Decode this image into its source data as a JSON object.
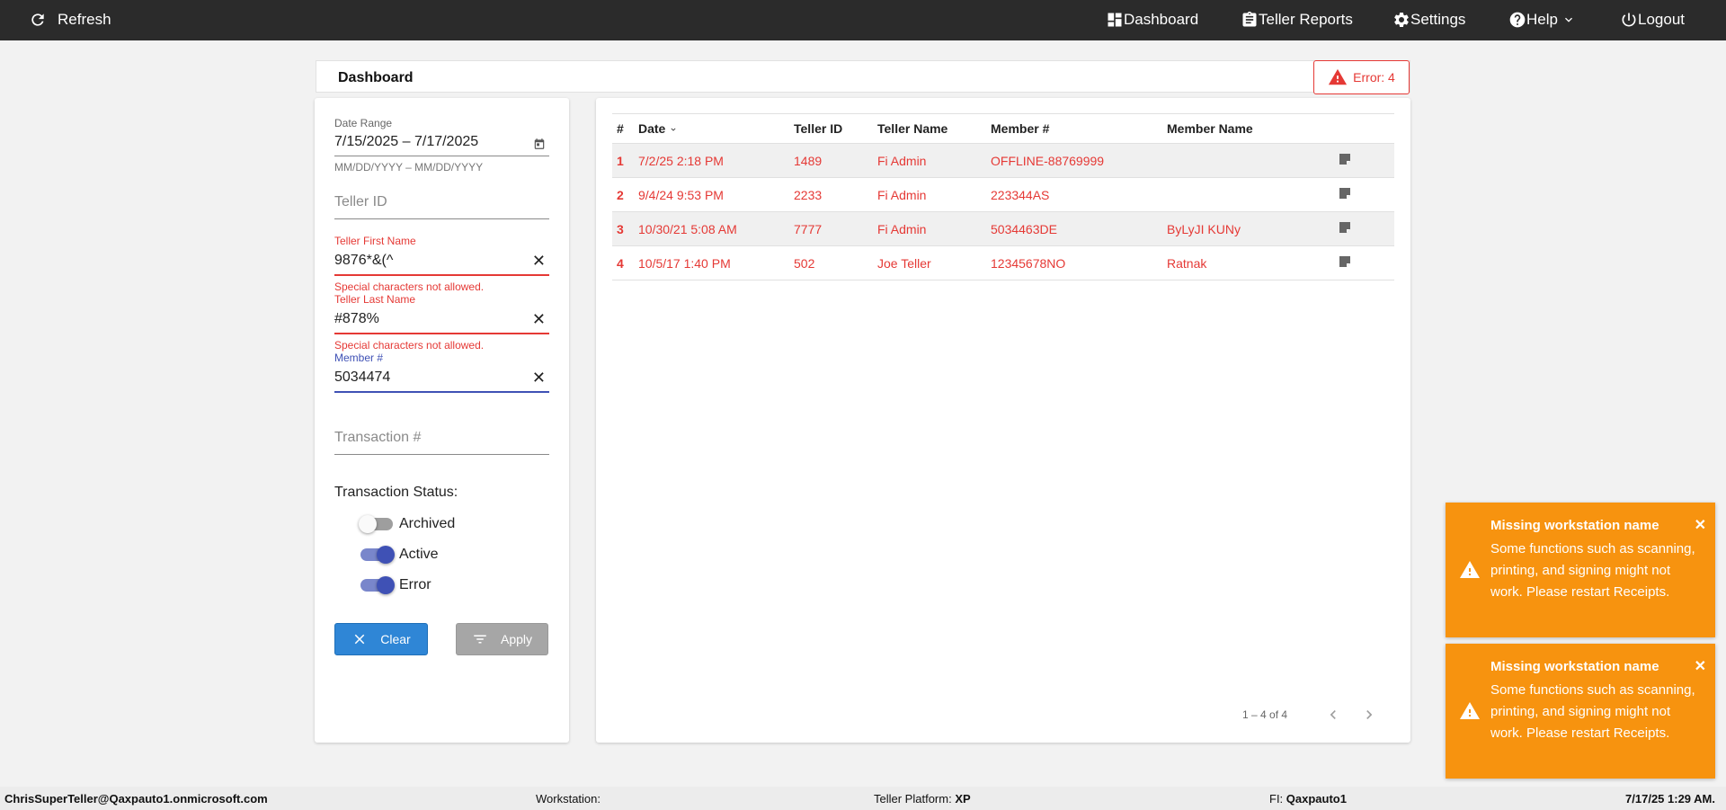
{
  "topbar": {
    "refresh_label": "Refresh",
    "dashboard_label": "Dashboard",
    "teller_reports_label": "Teller Reports",
    "settings_label": "Settings",
    "help_label": "Help",
    "logout_label": "Logout"
  },
  "header": {
    "title": "Dashboard",
    "error_label": "Error: 4"
  },
  "filters": {
    "date_range_label": "Date Range",
    "date_range_value": "7/15/2025 – 7/17/2025",
    "date_range_hint": "MM/DD/YYYY – MM/DD/YYYY",
    "teller_id_placeholder": "Teller ID",
    "first_name_label": "Teller First Name",
    "first_name_value": "9876*&(^",
    "first_name_error": "Special characters not allowed.",
    "last_name_label": "Teller Last Name",
    "last_name_value": "#878%",
    "last_name_error": "Special characters not allowed.",
    "member_label": "Member #",
    "member_value": "5034474",
    "transaction_placeholder": "Transaction #",
    "status_title": "Transaction Status:",
    "toggles": [
      {
        "label": "Archived",
        "on": false
      },
      {
        "label": "Active",
        "on": true
      },
      {
        "label": "Error",
        "on": true
      }
    ],
    "clear_label": "Clear",
    "apply_label": "Apply"
  },
  "table": {
    "columns": [
      "#",
      "Date",
      "Teller ID",
      "Teller Name",
      "Member #",
      "Member Name"
    ],
    "rows": [
      {
        "num": "1",
        "date": "7/2/25 2:18 PM",
        "teller_id": "1489",
        "teller_name": "Fi Admin",
        "member": "OFFLINE-88769999",
        "member_name": ""
      },
      {
        "num": "2",
        "date": "9/4/24 9:53 PM",
        "teller_id": "2233",
        "teller_name": "Fi Admin",
        "member": "223344AS",
        "member_name": ""
      },
      {
        "num": "3",
        "date": "10/30/21 5:08 AM",
        "teller_id": "7777",
        "teller_name": "Fi Admin",
        "member": "5034463DE",
        "member_name": "ByLyJI KUNy"
      },
      {
        "num": "4",
        "date": "10/5/17 1:40 PM",
        "teller_id": "502",
        "teller_name": "Joe Teller",
        "member": "12345678NO",
        "member_name": "Ratnak"
      }
    ],
    "pagination": "1 – 4 of 4"
  },
  "toasts": [
    {
      "title": "Missing workstation name",
      "body": "Some functions such as scanning, printing, and signing might not work. Please restart Receipts."
    },
    {
      "title": "Missing workstation name",
      "body": "Some functions such as scanning, printing, and signing might not work. Please restart Receipts."
    }
  ],
  "footer": {
    "user": "ChrisSuperTeller@Qaxpauto1.onmicrosoft.com",
    "workstation_label": "Workstation:",
    "platform_label": "Teller Platform:",
    "platform_value": "XP",
    "fi_label": "FI:",
    "fi_value": "Qaxpauto1",
    "datetime": "7/17/25 1:29 AM."
  },
  "colors": {
    "topbar": "#2b2b2b",
    "error_red": "#e53935",
    "primary_blue": "#3f51b5",
    "clear_button": "#2f86d6",
    "toast_orange": "#f7930f"
  }
}
